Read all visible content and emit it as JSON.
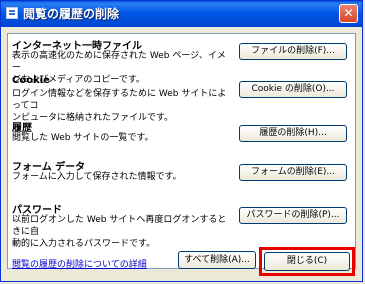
{
  "window": {
    "title": "閲覧の履歴の削除"
  },
  "sections": [
    {
      "title": "インターネット一時ファイル",
      "desc_line1": "表示の高速化のために保存された Web ページ、イメー",
      "desc_line2": "ジおよびメディアのコピーです。",
      "button": "ファイルの削除(F)..."
    },
    {
      "title": "Cookie",
      "desc_line1": "ログイン情報などを保存するために Web サイトによってコ",
      "desc_line2": "ンピュータに格納されたファイルです。",
      "button": "Cookie の削除(O)..."
    },
    {
      "title": "履歴",
      "desc_line1": "閲覧した Web サイトの一覧です。",
      "desc_line2": "",
      "button": "履歴の削除(H)..."
    },
    {
      "title": "フォーム データ",
      "desc_line1": "フォームに入力して保存された情報です。",
      "desc_line2": "",
      "button": "フォームの削除(E)..."
    },
    {
      "title": "パスワード",
      "desc_line1": "以前ログオンした Web サイトへ再度ログオンするときに自",
      "desc_line2": "動的に入力されるパスワードです。",
      "button": "パスワードの削除(P)..."
    }
  ],
  "footer": {
    "link": "閲覧の履歴の削除についての詳細",
    "delete_all": "すべて削除(A)...",
    "close": "閉じる(C)"
  },
  "colors": {
    "title_bar": "#0058e6",
    "highlight": "#e60000"
  }
}
